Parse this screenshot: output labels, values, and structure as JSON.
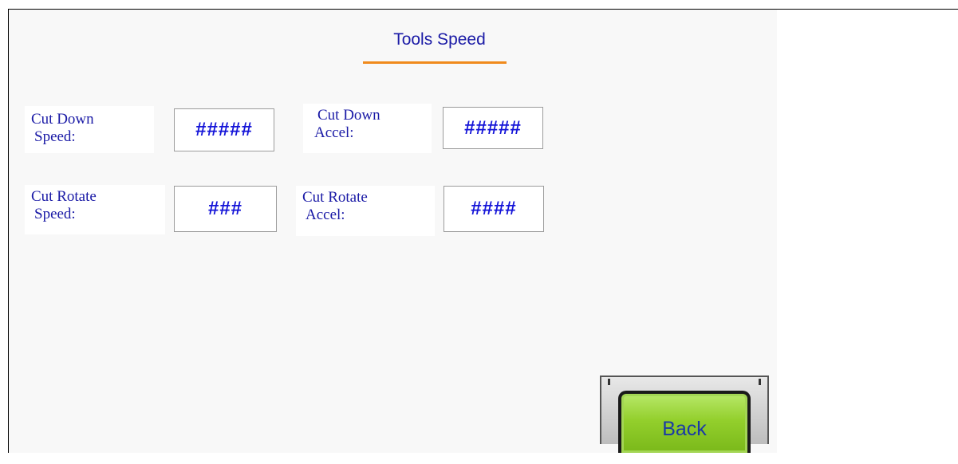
{
  "screen": {
    "title": "Tools Speed"
  },
  "fields": {
    "cut_down_speed": {
      "label_line1": "Cut Down",
      "label_line2": "Speed:",
      "value": "#####"
    },
    "cut_down_accel": {
      "label_line1": "Cut Down",
      "label_line2": "Accel:",
      "value": "#####"
    },
    "cut_rotate_speed": {
      "label_line1": "Cut Rotate",
      "label_line2": "Speed:",
      "value": "###"
    },
    "cut_rotate_accel": {
      "label_line1": "Cut Rotate",
      "label_line2": "Accel:",
      "value": "####"
    }
  },
  "buttons": {
    "back_label": "Back"
  },
  "colors": {
    "text_blue": "#1a1aa6",
    "value_blue": "#1414d8",
    "underline_orange": "#f08a1c",
    "button_green": "#93cf2c"
  }
}
